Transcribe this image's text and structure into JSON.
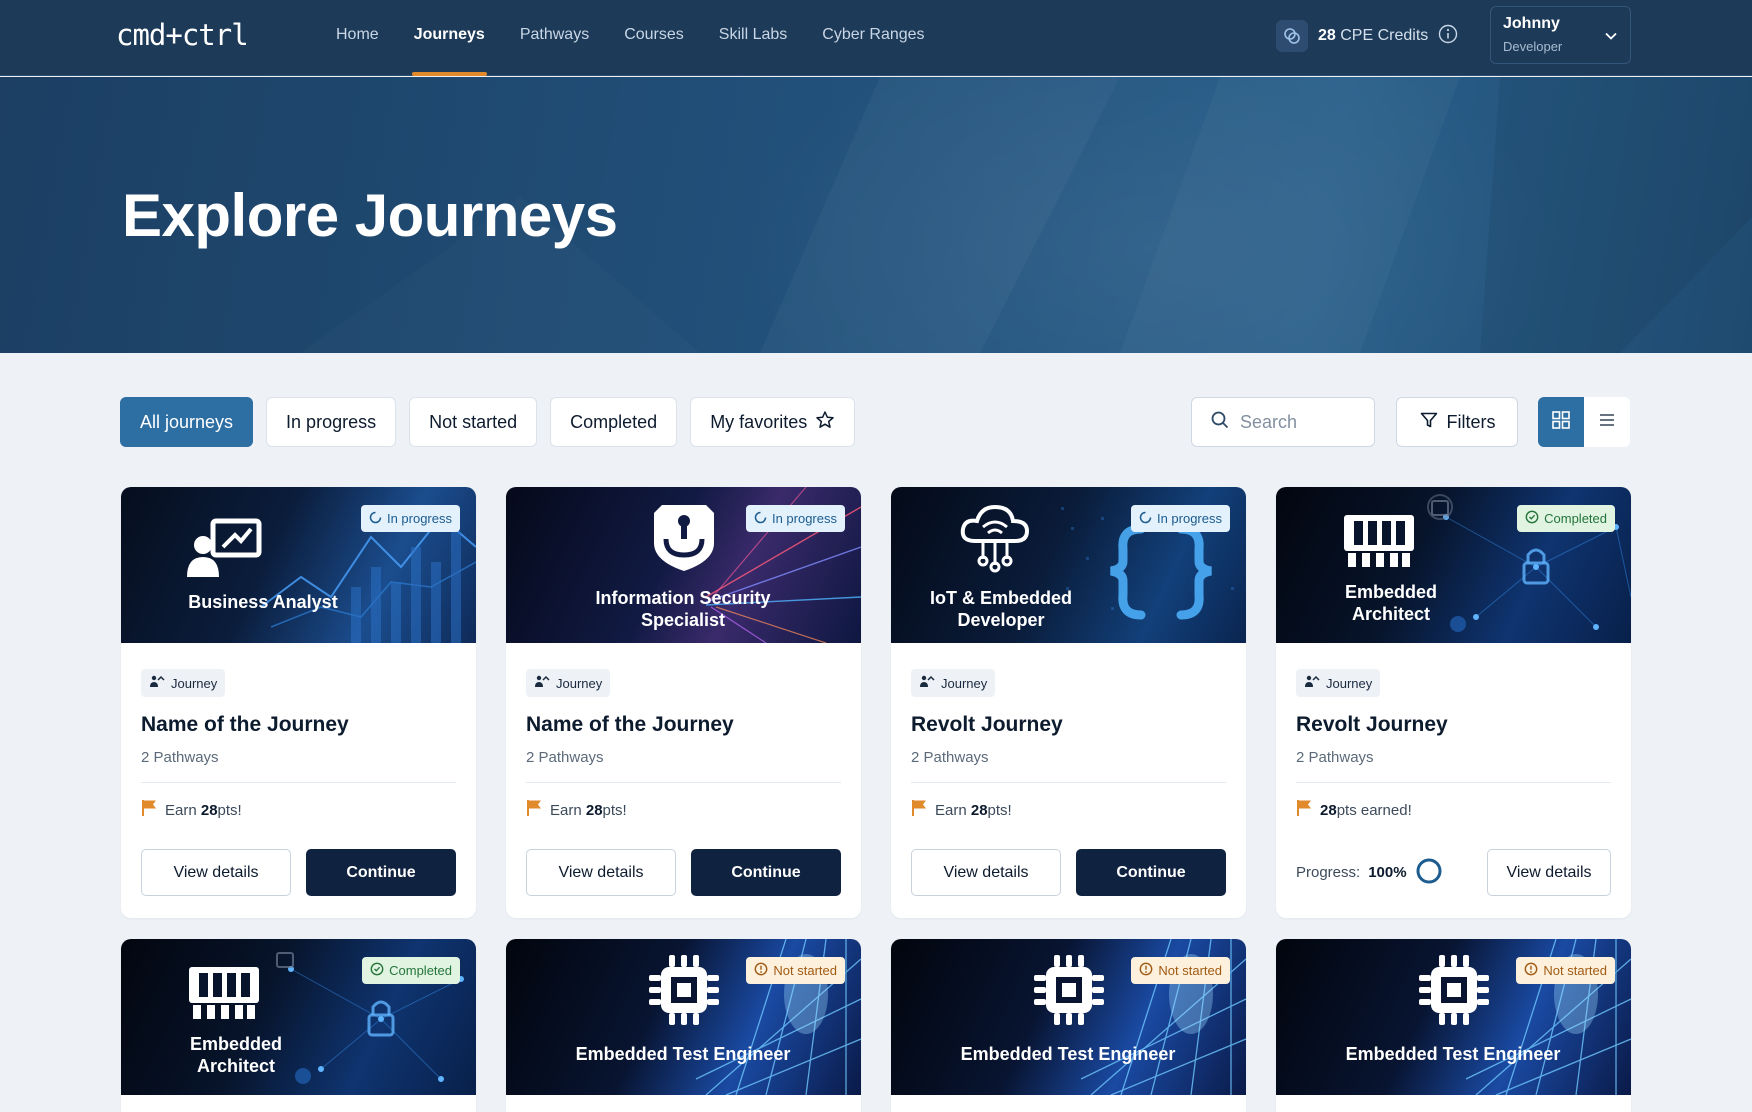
{
  "nav": {
    "logo": "cmd+ctrl",
    "links": [
      "Home",
      "Journeys",
      "Pathways",
      "Courses",
      "Skill Labs",
      "Cyber Ranges"
    ],
    "active_link": "Journeys",
    "cpe": {
      "value": "28",
      "label": "CPE Credits"
    },
    "user": {
      "name": "Johnny",
      "role": "Developer"
    }
  },
  "hero": {
    "title": "Explore Journeys"
  },
  "filters": {
    "tabs": [
      "All journeys",
      "In progress",
      "Not started",
      "Completed",
      "My favorites"
    ],
    "active_tab": "All journeys",
    "search_placeholder": "Search",
    "filters_label": "Filters"
  },
  "cards": [
    {
      "image_title": "Business Analyst",
      "status": "In progress",
      "tag": "Journey",
      "title": "Name of the Journey",
      "subtitle": "2 Pathways",
      "earn_prefix": "Earn",
      "points": "28",
      "earn_suffix": "pts!",
      "view_label": "View details",
      "cta_label": "Continue"
    },
    {
      "image_title": "Information Security Specialist",
      "status": "In progress",
      "tag": "Journey",
      "title": "Name of the Journey",
      "subtitle": "2 Pathways",
      "earn_prefix": "Earn",
      "points": "28",
      "earn_suffix": "pts!",
      "view_label": "View details",
      "cta_label": "Continue"
    },
    {
      "image_title": "IoT & Embedded Developer",
      "status": "In progress",
      "tag": "Journey",
      "title": "Revolt Journey",
      "subtitle": "2 Pathways",
      "earn_prefix": "Earn",
      "points": "28",
      "earn_suffix": "pts!",
      "view_label": "View details",
      "cta_label": "Continue"
    },
    {
      "image_title": "Embedded Architect",
      "status": "Completed",
      "tag": "Journey",
      "title": "Revolt Journey",
      "subtitle": "2 Pathways",
      "points": "28",
      "earned_suffix": "pts earned!",
      "progress_label": "Progress:",
      "progress_value": "100%",
      "view_label": "View details"
    },
    {
      "image_title": "Embedded Architect",
      "status": "Completed"
    },
    {
      "image_title": "Embedded Test Engineer",
      "status": "Not started"
    },
    {
      "image_title": "Embedded Test Engineer",
      "status": "Not started"
    },
    {
      "image_title": "Embedded Test Engineer",
      "status": "Not started"
    }
  ],
  "colors": {
    "nav_bg": "#1d3a58",
    "accent": "#2d6ea3",
    "active_underline": "#e08a2c",
    "primary_button": "#0f2340",
    "flag": "#e08a2c"
  }
}
